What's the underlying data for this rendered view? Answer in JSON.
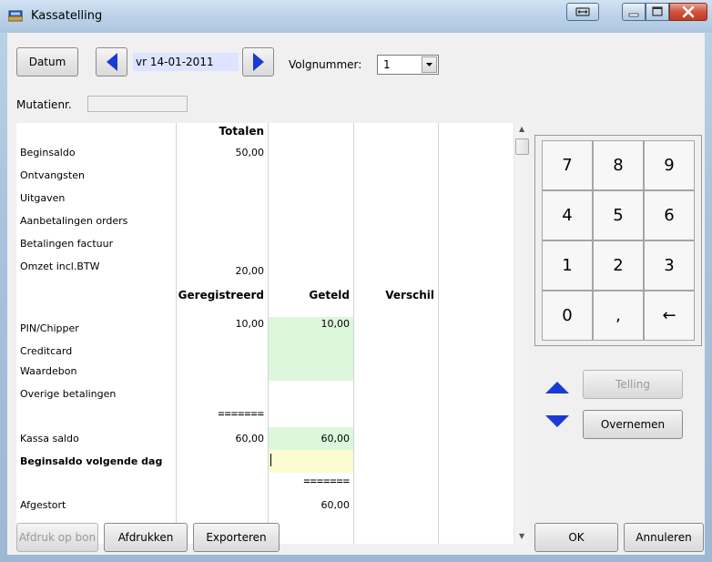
{
  "window": {
    "title": "Kassatelling"
  },
  "toolbar": {
    "datum_label": "Datum",
    "date_value": "vr 14-01-2011",
    "volgnummer_label": "Volgnummer:",
    "volgnummer_value": "1",
    "mutatienr_label": "Mutatienr.",
    "mutatienr_value": ""
  },
  "grid": {
    "header_totalen": "Totalen",
    "rows_top": [
      {
        "label": "Beginsaldo",
        "totaal": "50,00"
      },
      {
        "label": "Ontvangsten",
        "totaal": ""
      },
      {
        "label": "Uitgaven",
        "totaal": ""
      },
      {
        "label": "Aanbetalingen orders",
        "totaal": ""
      },
      {
        "label": "Betalingen factuur",
        "totaal": ""
      },
      {
        "label": "Omzet incl.BTW",
        "totaal": "20,00"
      }
    ],
    "header_geregistreerd": "Geregistreerd",
    "header_geteld": "Geteld",
    "header_verschil": "Verschil",
    "rows_payments": [
      {
        "label": "PIN/Chipper",
        "geregistreerd": "10,00",
        "geteld": "10,00"
      },
      {
        "label": "Creditcard",
        "geregistreerd": "",
        "geteld": ""
      },
      {
        "label": "Waardebon",
        "geregistreerd": "",
        "geteld": ""
      },
      {
        "label": "Overige betalingen",
        "geregistreerd": "",
        "geteld": ""
      }
    ],
    "separator": "=======",
    "kassa_saldo_label": "Kassa saldo",
    "kassa_saldo_geregistreerd": "60,00",
    "kassa_saldo_geteld": "60,00",
    "beginsaldo_volgende_label": "Beginsaldo volgende dag",
    "beginsaldo_volgende_value": "",
    "separator2": "=======",
    "afgestort_label": "Afgestort",
    "afgestort_value": "60,00"
  },
  "keypad": {
    "keys": [
      "7",
      "8",
      "9",
      "4",
      "5",
      "6",
      "1",
      "2",
      "3",
      "0",
      ",",
      "←"
    ]
  },
  "side_buttons": {
    "telling": "Telling",
    "overnemen": "Overnemen"
  },
  "bottom_buttons": {
    "afdruk_op_bon": "Afdruk op bon",
    "afdrukken": "Afdrukken",
    "exporteren": "Exporteren",
    "ok": "OK",
    "annuleren": "Annuleren"
  },
  "colors": {
    "accent_arrow": "#1a3ad4",
    "counted_cell": "#dcf7dc",
    "input_cell": "#fdfbd0",
    "date_field": "#dde4ff"
  }
}
